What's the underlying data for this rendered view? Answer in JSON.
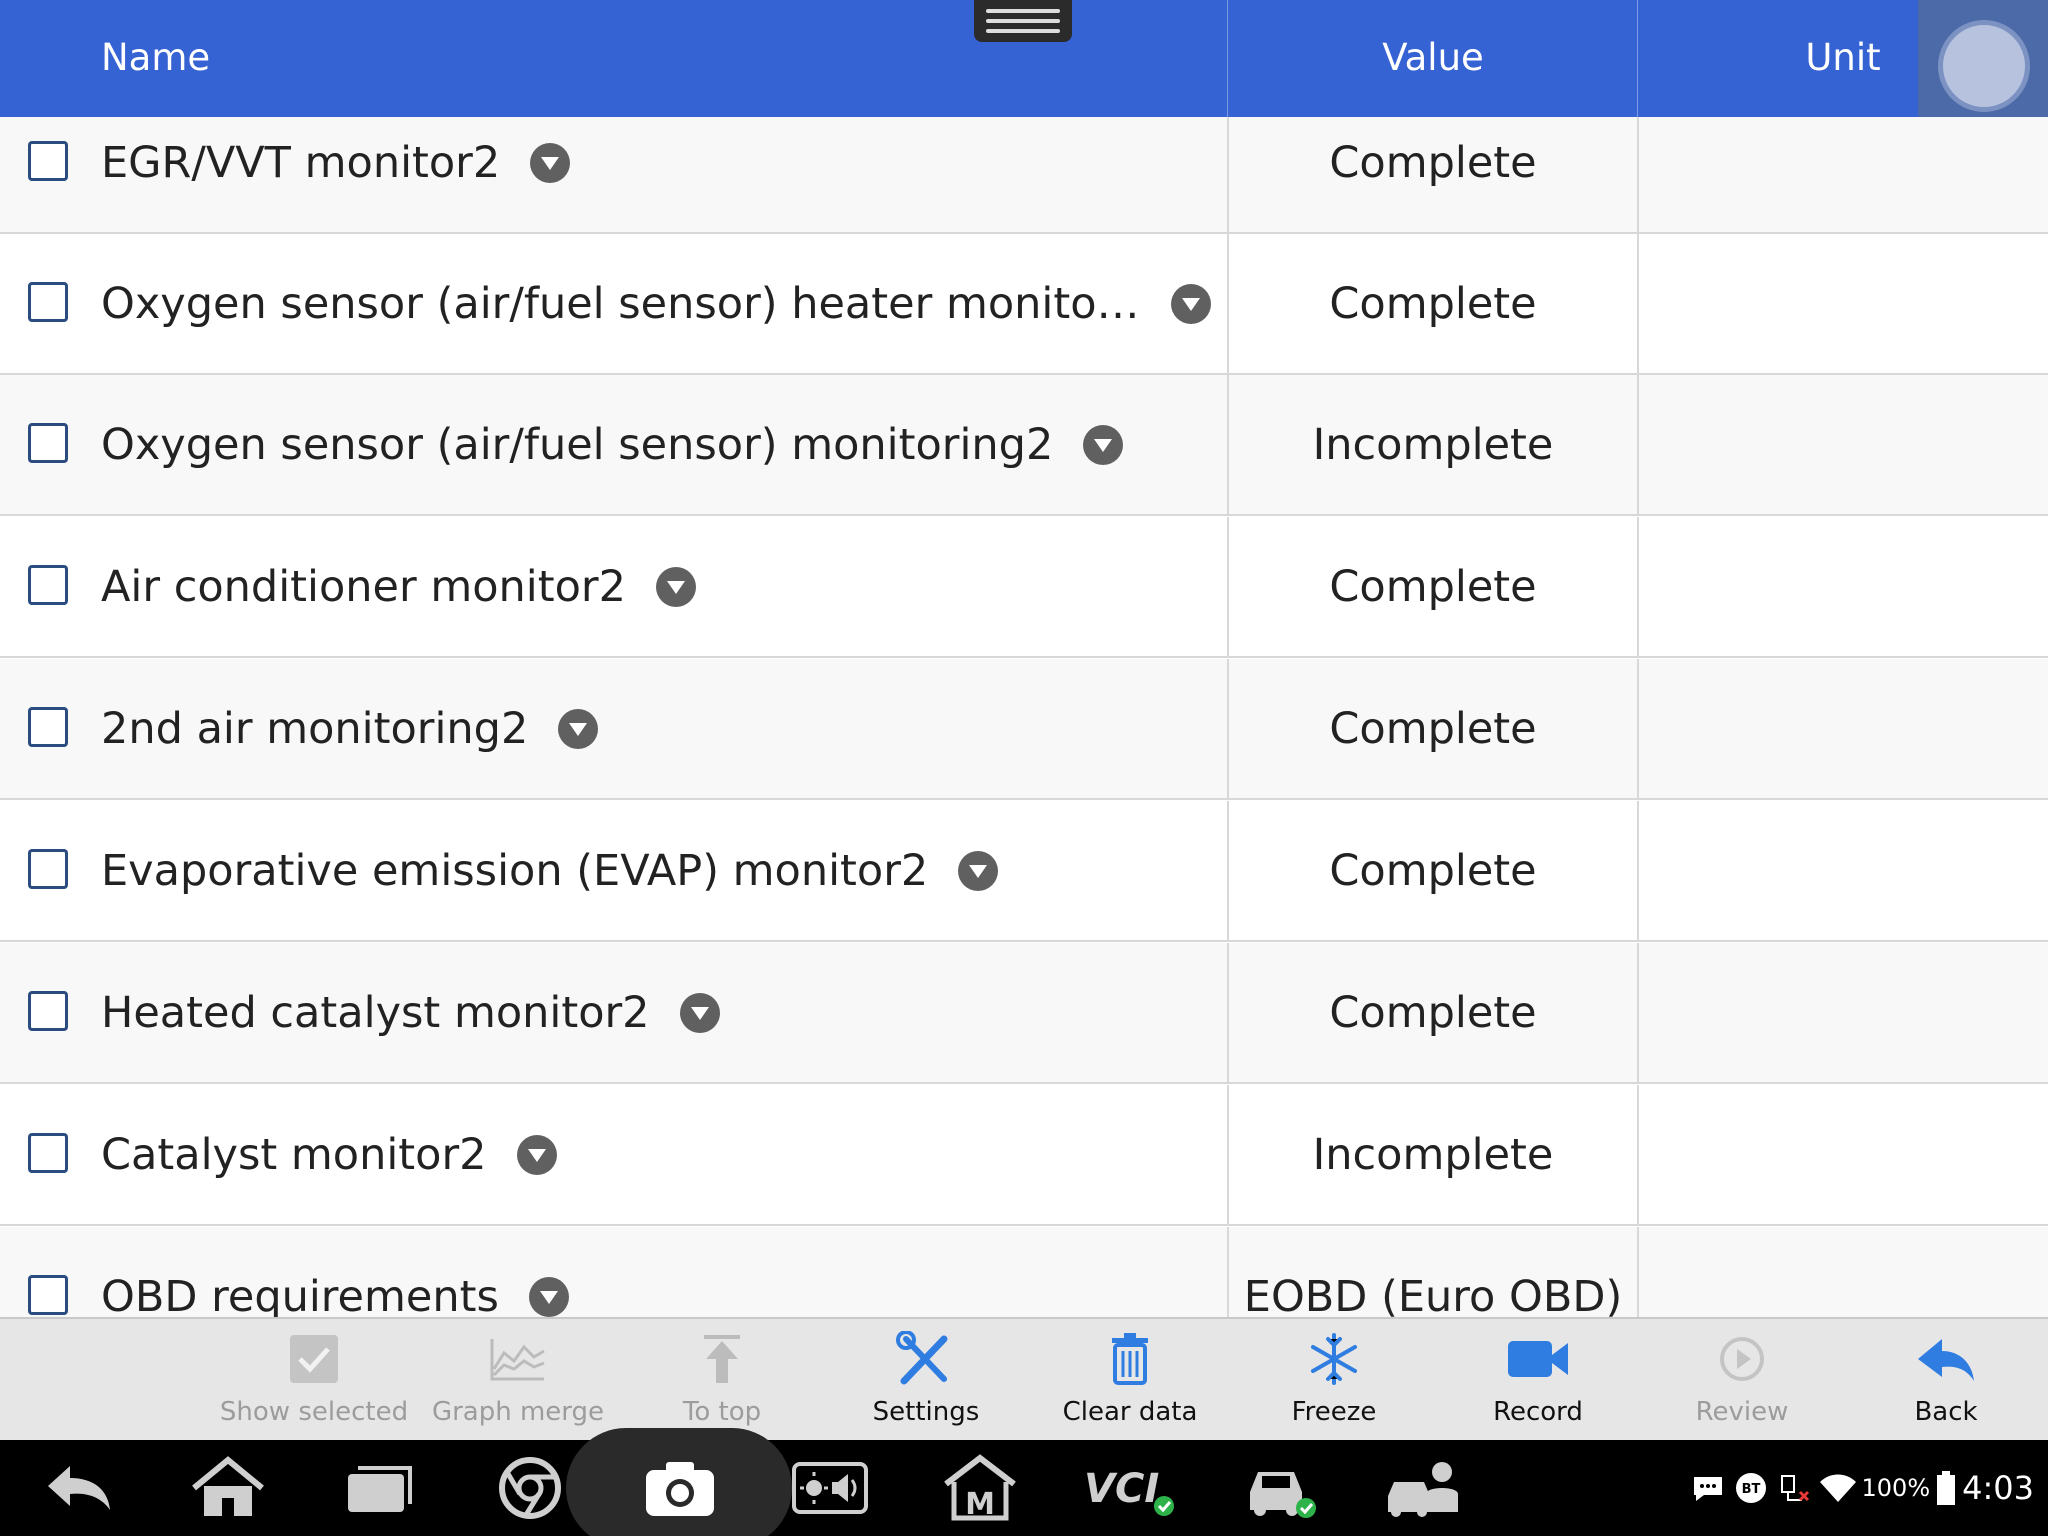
{
  "header": {
    "name_label": "Name",
    "value_label": "Value",
    "unit_label": "Unit"
  },
  "rows": [
    {
      "name": "EGR/VVT monitor2",
      "value": "Complete"
    },
    {
      "name": "Oxygen sensor (air/fuel sensor) heater monitori...",
      "value": "Complete"
    },
    {
      "name": "Oxygen sensor (air/fuel sensor) monitoring2",
      "value": "Incomplete"
    },
    {
      "name": "Air conditioner monitor2",
      "value": "Complete"
    },
    {
      "name": "2nd air monitoring2",
      "value": "Complete"
    },
    {
      "name": "Evaporative emission (EVAP) monitor2",
      "value": "Complete"
    },
    {
      "name": "Heated catalyst monitor2",
      "value": "Complete"
    },
    {
      "name": "Catalyst monitor2",
      "value": "Incomplete"
    },
    {
      "name": "OBD requirements",
      "value": "EOBD (Euro OBD)"
    }
  ],
  "toolbar": {
    "show_selected": "Show selected",
    "graph_merge": "Graph merge",
    "to_top": "To top",
    "settings": "Settings",
    "clear_data": "Clear data",
    "freeze": "Freeze",
    "record": "Record",
    "review": "Review",
    "back": "Back"
  },
  "status_bar": {
    "bt_label": "BT",
    "battery_pct": "100%",
    "time": "4:03",
    "vci_label": "VCI",
    "m_label": "M"
  },
  "colors": {
    "header_bg": "#3663d3",
    "accent_blue": "#2f7de1",
    "ok_green": "#2db34a"
  }
}
